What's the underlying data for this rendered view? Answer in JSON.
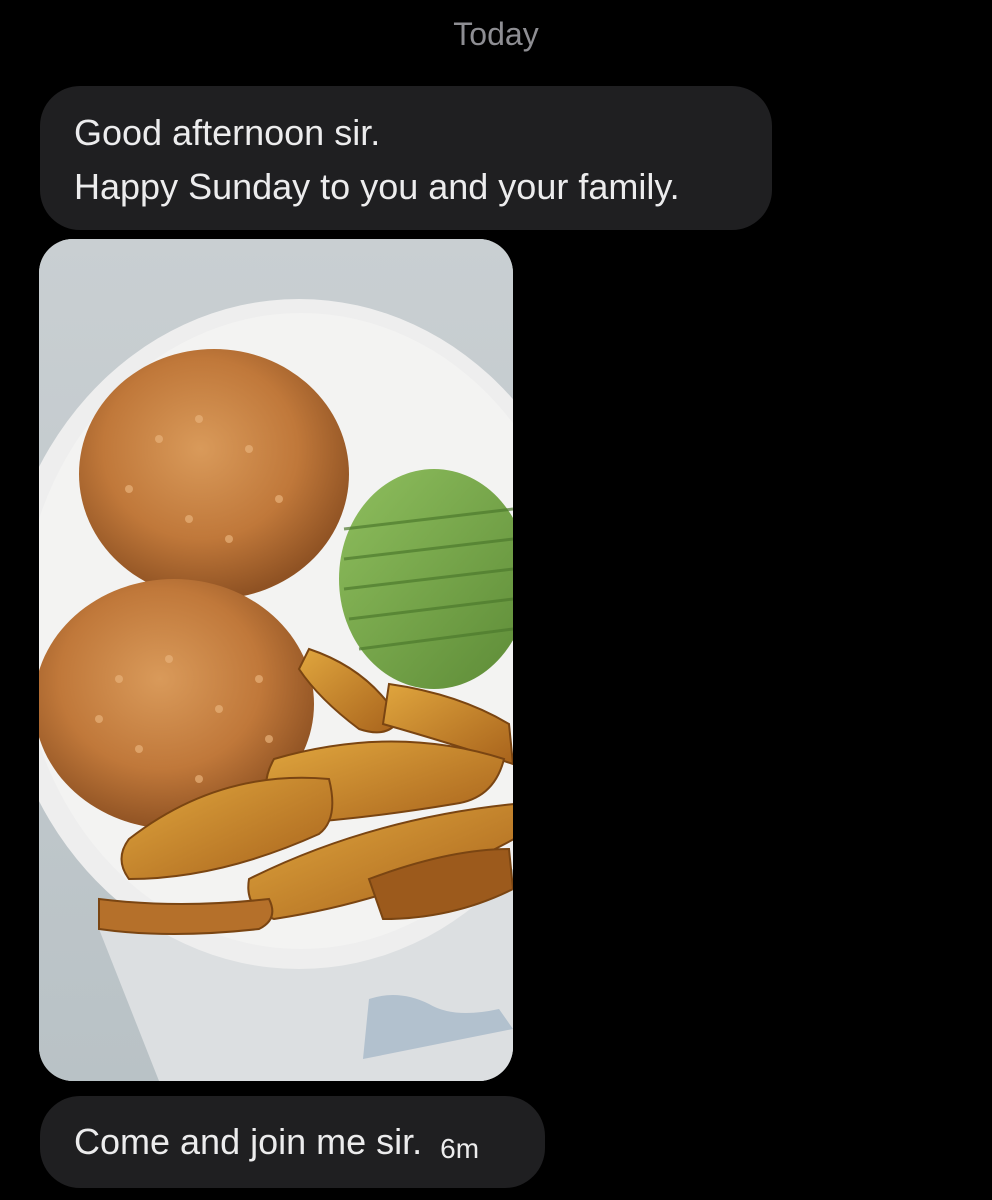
{
  "date_separator": "Today",
  "messages": [
    {
      "lines": [
        "Good afternoon sir.",
        "Happy Sunday to you and your family."
      ]
    },
    {
      "image": "photo of a plate with two mounds of jollof rice, sliced avocado and fried plantains"
    },
    {
      "text": "Come and join me sir.",
      "time": "6m"
    }
  ],
  "colors": {
    "background": "#000000",
    "bubble": "#1f1f21",
    "text": "#ececed",
    "muted": "#8e8e93"
  }
}
